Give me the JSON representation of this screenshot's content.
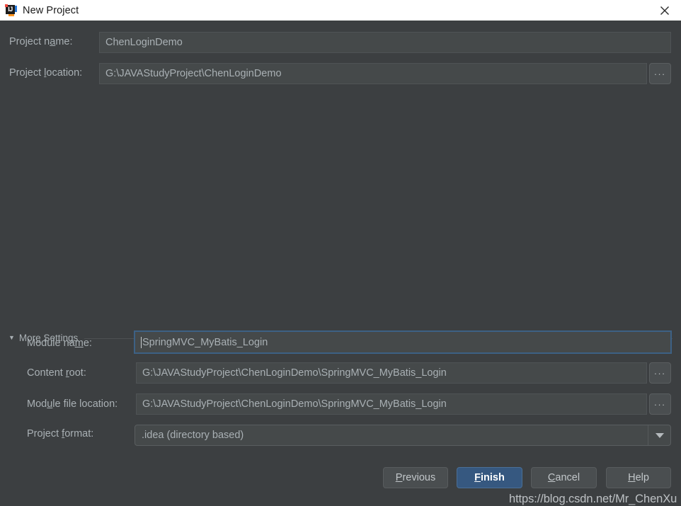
{
  "window": {
    "title": "New Project",
    "app_icon": "intellij-idea-icon",
    "icon_letters": "IJ",
    "close_icon": "close-icon"
  },
  "top_section": {
    "project_name": {
      "label_before": "Project n",
      "label_mnemonic": "a",
      "label_after": "me:",
      "value": "ChenLoginDemo"
    },
    "project_location": {
      "label_before": "Project ",
      "label_mnemonic": "l",
      "label_after": "ocation:",
      "value": "G:\\JAVAStudyProject\\ChenLoginDemo",
      "browse_label": "..."
    }
  },
  "more_settings": {
    "arrow": "▼",
    "label_before": "Mor",
    "label_mnemonic": "e",
    "label_after": " Settings",
    "expanded": true
  },
  "settings": {
    "module_name": {
      "label_before": "Module na",
      "label_mnemonic": "m",
      "label_after": "e:",
      "value": "SpringMVC_MyBatis_Login",
      "focused": true
    },
    "content_root": {
      "label_before": "Content ",
      "label_mnemonic": "r",
      "label_after": "oot:",
      "value": "G:\\JAVAStudyProject\\ChenLoginDemo\\SpringMVC_MyBatis_Login",
      "browse_label": "..."
    },
    "module_file_location": {
      "label_before": "Mod",
      "label_mnemonic": "u",
      "label_after": "le file location:",
      "value": "G:\\JAVAStudyProject\\ChenLoginDemo\\SpringMVC_MyBatis_Login",
      "browse_label": "..."
    },
    "project_format": {
      "label_before": "Project ",
      "label_mnemonic": "f",
      "label_after": "ormat:",
      "value": ".idea (directory based)",
      "dropdown_icon": "chevron-down-icon"
    }
  },
  "buttons": {
    "previous": {
      "before": "",
      "mnemonic": "P",
      "after": "revious"
    },
    "finish": {
      "before": "",
      "mnemonic": "F",
      "after": "inish"
    },
    "cancel": {
      "before": "",
      "mnemonic": "C",
      "after": "ancel"
    },
    "help": {
      "before": "",
      "mnemonic": "H",
      "after": "elp"
    }
  },
  "watermark": {
    "text": "https://blog.csdn.net/Mr_ChenXu"
  },
  "colors": {
    "dialog_background": "#3c3f41",
    "titlebar_background": "#ffffff",
    "field_background": "#45494a",
    "text": "#a9b0b4",
    "focus_border": "#3d6185",
    "primary_button": "#365880"
  }
}
